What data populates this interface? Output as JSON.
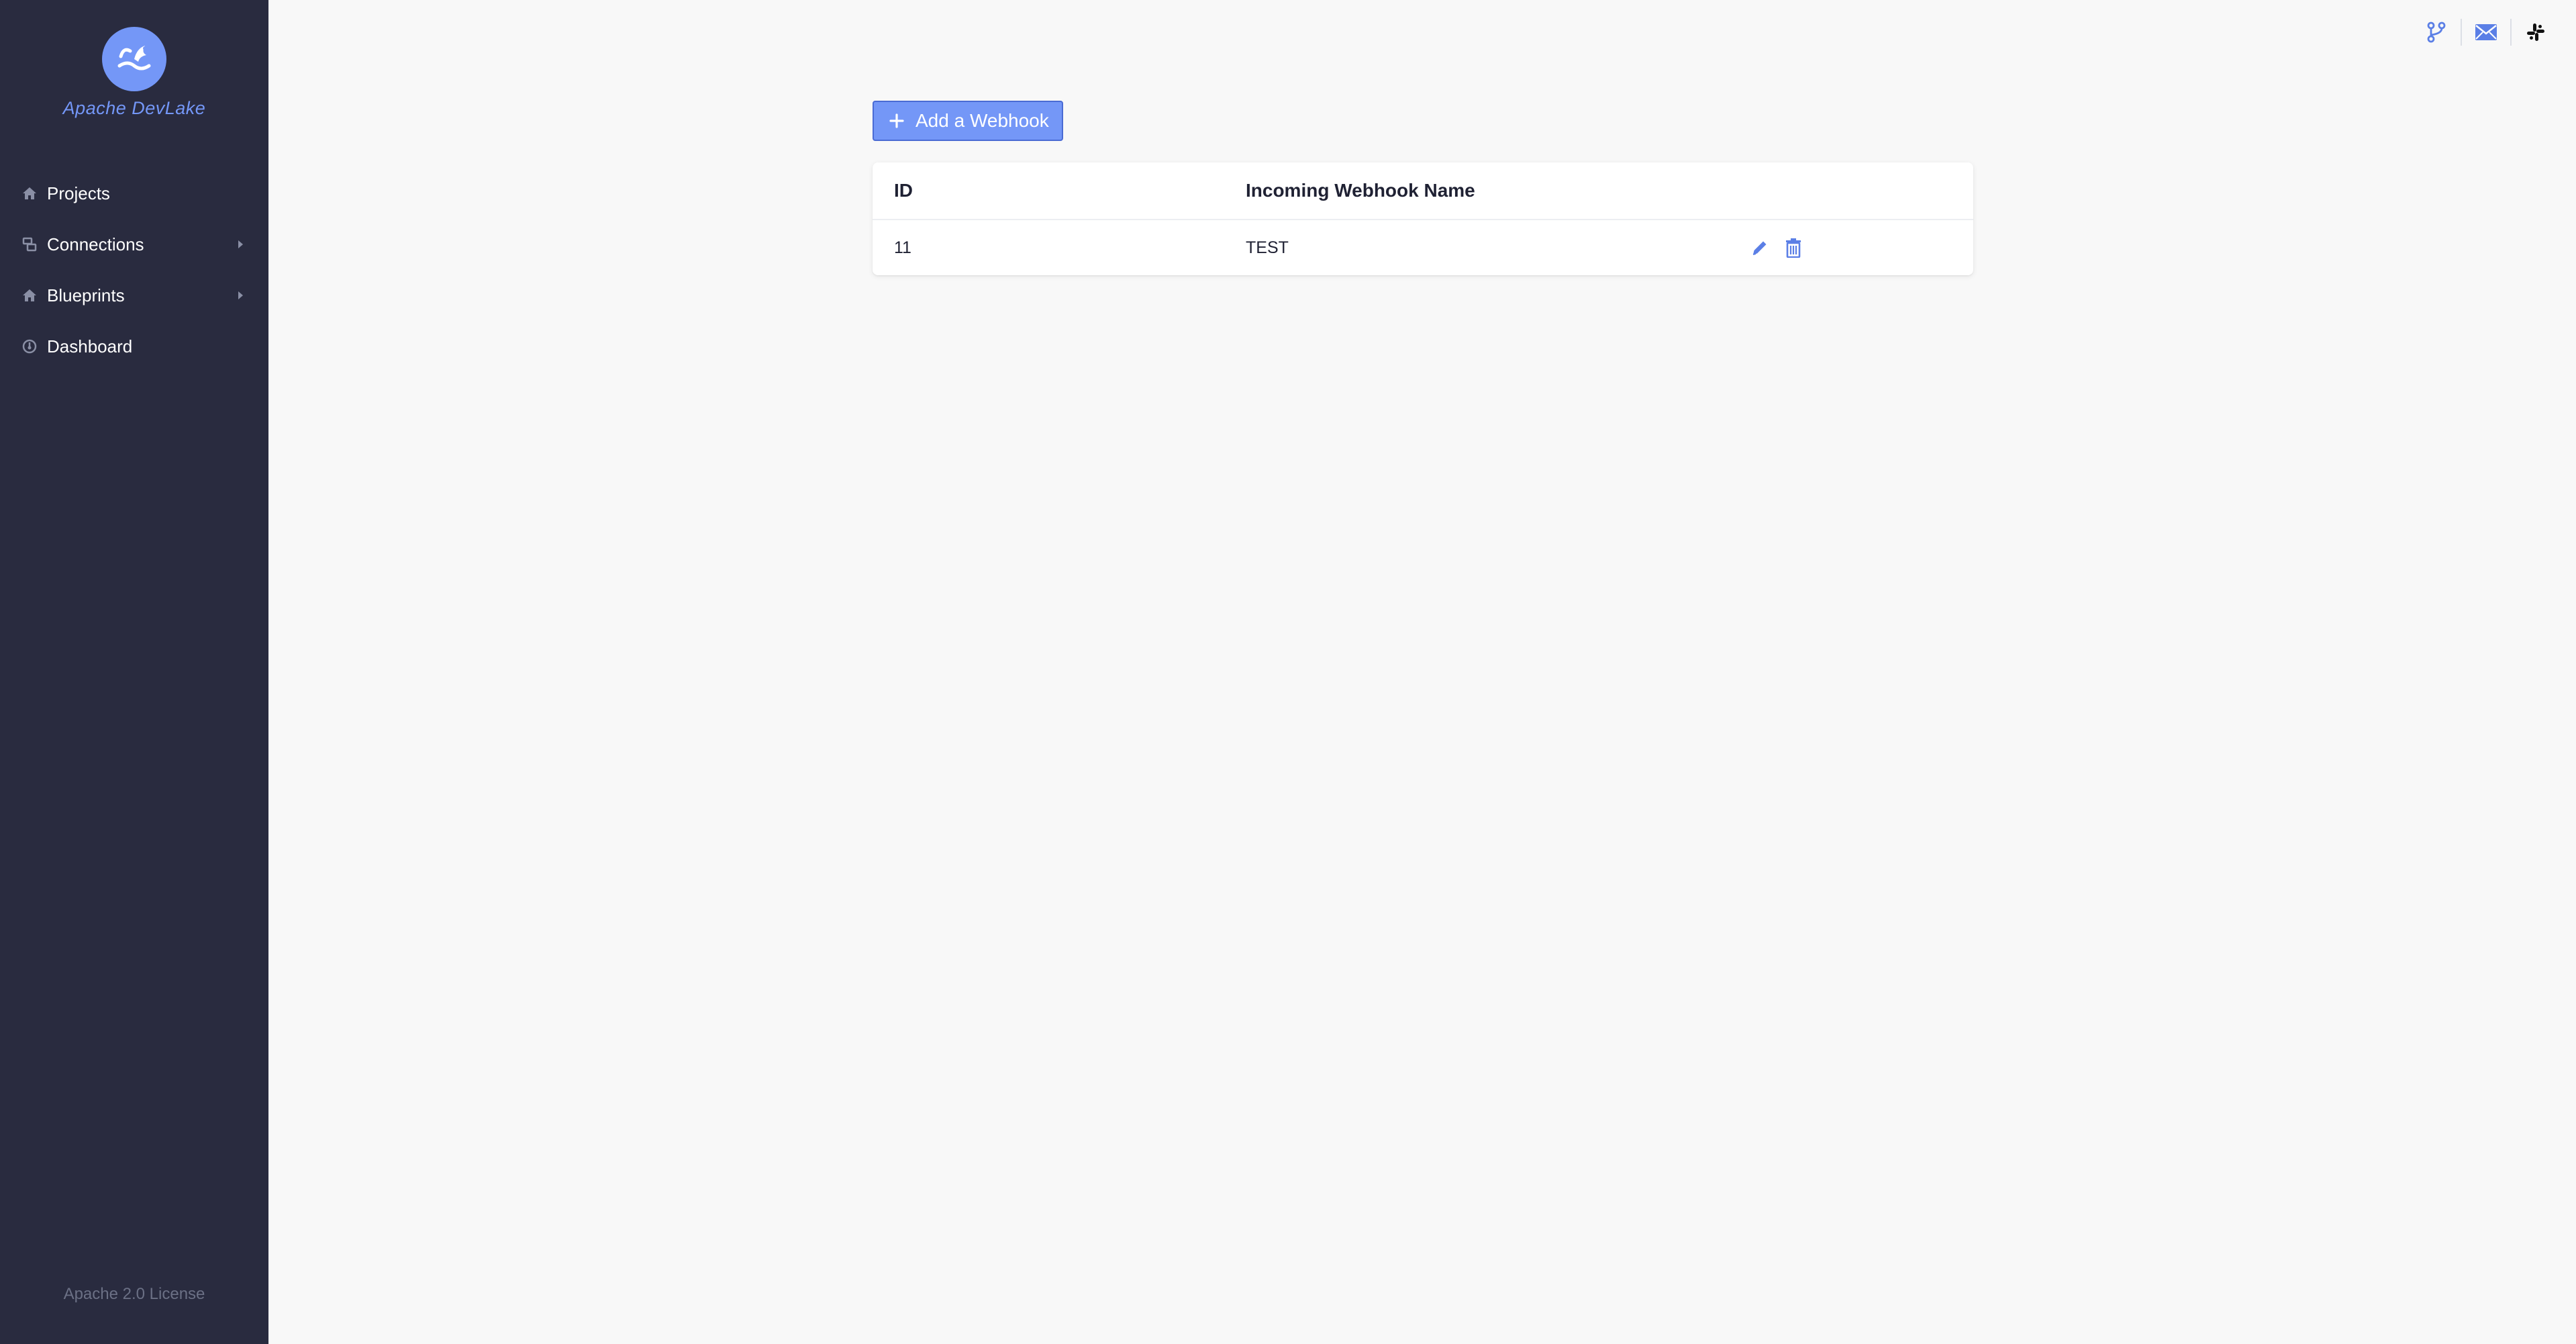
{
  "sidebar": {
    "logo_text": "Apache DevLake",
    "items": [
      {
        "label": "Projects",
        "icon": "home-icon",
        "has_submenu": false
      },
      {
        "label": "Connections",
        "icon": "database-icon",
        "has_submenu": true
      },
      {
        "label": "Blueprints",
        "icon": "home-icon",
        "has_submenu": true
      },
      {
        "label": "Dashboard",
        "icon": "dashboard-icon",
        "has_submenu": false
      }
    ],
    "footer": "Apache 2.0 License"
  },
  "header": {
    "icons": [
      "git-branch-icon",
      "mail-icon",
      "slack-icon"
    ]
  },
  "main": {
    "add_button_label": "Add a Webhook",
    "table": {
      "columns": [
        "ID",
        "Incoming Webhook Name",
        ""
      ],
      "rows": [
        {
          "id": "11",
          "name": "TEST",
          "actions": [
            "edit-icon",
            "delete-icon"
          ]
        }
      ]
    }
  },
  "colors": {
    "sidebar_bg": "#292b3f",
    "accent": "#7497f7",
    "page_bg": "#f8f8f8"
  }
}
